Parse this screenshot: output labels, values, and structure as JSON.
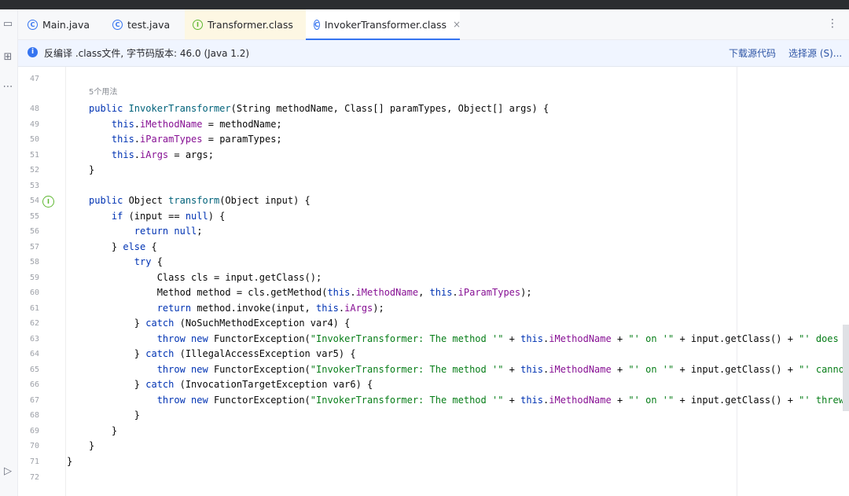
{
  "tabs": [
    {
      "label": "Main.java",
      "icon": "class-icon",
      "active": false
    },
    {
      "label": "test.java",
      "icon": "class-icon",
      "active": false
    },
    {
      "label": "Transformer.class",
      "icon": "interface-icon",
      "active": false
    },
    {
      "label": "InvokerTransformer.class",
      "icon": "class-icon",
      "active": true,
      "close": "×"
    }
  ],
  "tabs_menu": "⋮",
  "banner": {
    "message": "反编译 .class文件, 字节码版本: 46.0 (Java 1.2)",
    "download_link": "下载源代码",
    "choose_link": "选择源 (S)..."
  },
  "usage_hint": "5个用法",
  "editor": {
    "line_numbers": [
      "47",
      "48",
      "49",
      "50",
      "51",
      "52",
      "53",
      "54",
      "55",
      "56",
      "57",
      "58",
      "59",
      "60",
      "61",
      "62",
      "63",
      "64",
      "65",
      "66",
      "67",
      "68",
      "69",
      "70",
      "71",
      "72"
    ],
    "lines": [
      [],
      [
        {
          "t": "public ",
          "c": "kw"
        },
        {
          "t": "InvokerTransformer",
          "c": "fn"
        },
        {
          "t": "(String methodName, Class[] paramTypes, Object[] args) {",
          "c": ""
        }
      ],
      [
        {
          "t": "    this",
          "c": "kw"
        },
        {
          "t": ".",
          "c": ""
        },
        {
          "t": "iMethodName",
          "c": "fd"
        },
        {
          "t": " = methodName;",
          "c": ""
        }
      ],
      [
        {
          "t": "    this",
          "c": "kw"
        },
        {
          "t": ".",
          "c": ""
        },
        {
          "t": "iParamTypes",
          "c": "fd"
        },
        {
          "t": " = paramTypes;",
          "c": ""
        }
      ],
      [
        {
          "t": "    this",
          "c": "kw"
        },
        {
          "t": ".",
          "c": ""
        },
        {
          "t": "iArgs",
          "c": "fd"
        },
        {
          "t": " = args;",
          "c": ""
        }
      ],
      [
        {
          "t": "}",
          "c": ""
        }
      ],
      [],
      [
        {
          "t": "public ",
          "c": "kw"
        },
        {
          "t": "Object ",
          "c": ""
        },
        {
          "t": "transform",
          "c": "fn"
        },
        {
          "t": "(Object input) {",
          "c": ""
        }
      ],
      [
        {
          "t": "    if ",
          "c": "kw"
        },
        {
          "t": "(input == ",
          "c": ""
        },
        {
          "t": "null",
          "c": "kw"
        },
        {
          "t": ") {",
          "c": ""
        }
      ],
      [
        {
          "t": "        return null",
          "c": "kw"
        },
        {
          "t": ";",
          "c": ""
        }
      ],
      [
        {
          "t": "    } ",
          "c": ""
        },
        {
          "t": "else ",
          "c": "kw"
        },
        {
          "t": "{",
          "c": ""
        }
      ],
      [
        {
          "t": "        try ",
          "c": "kw"
        },
        {
          "t": "{",
          "c": ""
        }
      ],
      [
        {
          "t": "            Class cls = input.getClass();",
          "c": ""
        }
      ],
      [
        {
          "t": "            Method method = cls.getMethod(",
          "c": ""
        },
        {
          "t": "this",
          "c": "kw"
        },
        {
          "t": ".",
          "c": ""
        },
        {
          "t": "iMethodName",
          "c": "fd"
        },
        {
          "t": ", ",
          "c": ""
        },
        {
          "t": "this",
          "c": "kw"
        },
        {
          "t": ".",
          "c": ""
        },
        {
          "t": "iParamTypes",
          "c": "fd"
        },
        {
          "t": ");",
          "c": ""
        }
      ],
      [
        {
          "t": "            return ",
          "c": "kw"
        },
        {
          "t": "method.invoke(input, ",
          "c": ""
        },
        {
          "t": "this",
          "c": "kw"
        },
        {
          "t": ".",
          "c": ""
        },
        {
          "t": "iArgs",
          "c": "fd"
        },
        {
          "t": ");",
          "c": ""
        }
      ],
      [
        {
          "t": "        } ",
          "c": ""
        },
        {
          "t": "catch ",
          "c": "kw"
        },
        {
          "t": "(NoSuchMethodException var4) {",
          "c": ""
        }
      ],
      [
        {
          "t": "            throw new ",
          "c": "kw"
        },
        {
          "t": "FunctorException(",
          "c": ""
        },
        {
          "t": "\"InvokerTransformer: The method '\"",
          "c": "st"
        },
        {
          "t": " + ",
          "c": ""
        },
        {
          "t": "this",
          "c": "kw"
        },
        {
          "t": ".",
          "c": ""
        },
        {
          "t": "iMethodName",
          "c": "fd"
        },
        {
          "t": " + ",
          "c": ""
        },
        {
          "t": "\"' on '\"",
          "c": "st"
        },
        {
          "t": " + input.getClass() + ",
          "c": ""
        },
        {
          "t": "\"' does not exist\");",
          "c": "st"
        }
      ],
      [
        {
          "t": "        } ",
          "c": ""
        },
        {
          "t": "catch ",
          "c": "kw"
        },
        {
          "t": "(IllegalAccessException var5) {",
          "c": ""
        }
      ],
      [
        {
          "t": "            throw new ",
          "c": "kw"
        },
        {
          "t": "FunctorException(",
          "c": ""
        },
        {
          "t": "\"InvokerTransformer: The method '\"",
          "c": "st"
        },
        {
          "t": " + ",
          "c": ""
        },
        {
          "t": "this",
          "c": "kw"
        },
        {
          "t": ".",
          "c": ""
        },
        {
          "t": "iMethodName",
          "c": "fd"
        },
        {
          "t": " + ",
          "c": ""
        },
        {
          "t": "\"' on '\"",
          "c": "st"
        },
        {
          "t": " + input.getClass() + ",
          "c": ""
        },
        {
          "t": "\"' cannot be accessed\");",
          "c": "st"
        }
      ],
      [
        {
          "t": "        } ",
          "c": ""
        },
        {
          "t": "catch ",
          "c": "kw"
        },
        {
          "t": "(InvocationTargetException var6) {",
          "c": ""
        }
      ],
      [
        {
          "t": "            throw new ",
          "c": "kw"
        },
        {
          "t": "FunctorException(",
          "c": ""
        },
        {
          "t": "\"InvokerTransformer: The method '\"",
          "c": "st"
        },
        {
          "t": " + ",
          "c": ""
        },
        {
          "t": "this",
          "c": "kw"
        },
        {
          "t": ".",
          "c": ""
        },
        {
          "t": "iMethodName",
          "c": "fd"
        },
        {
          "t": " + ",
          "c": ""
        },
        {
          "t": "\"' on '\"",
          "c": "st"
        },
        {
          "t": " + input.getClass() + ",
          "c": ""
        },
        {
          "t": "\"' threw an exception\");",
          "c": "st"
        }
      ],
      [
        {
          "t": "        }",
          "c": ""
        }
      ],
      [
        {
          "t": "    }",
          "c": ""
        }
      ],
      [
        {
          "t": "}",
          "c": ""
        }
      ],
      [
        {
          "t": "}",
          "c": "",
          "dedent": true
        }
      ],
      []
    ]
  }
}
